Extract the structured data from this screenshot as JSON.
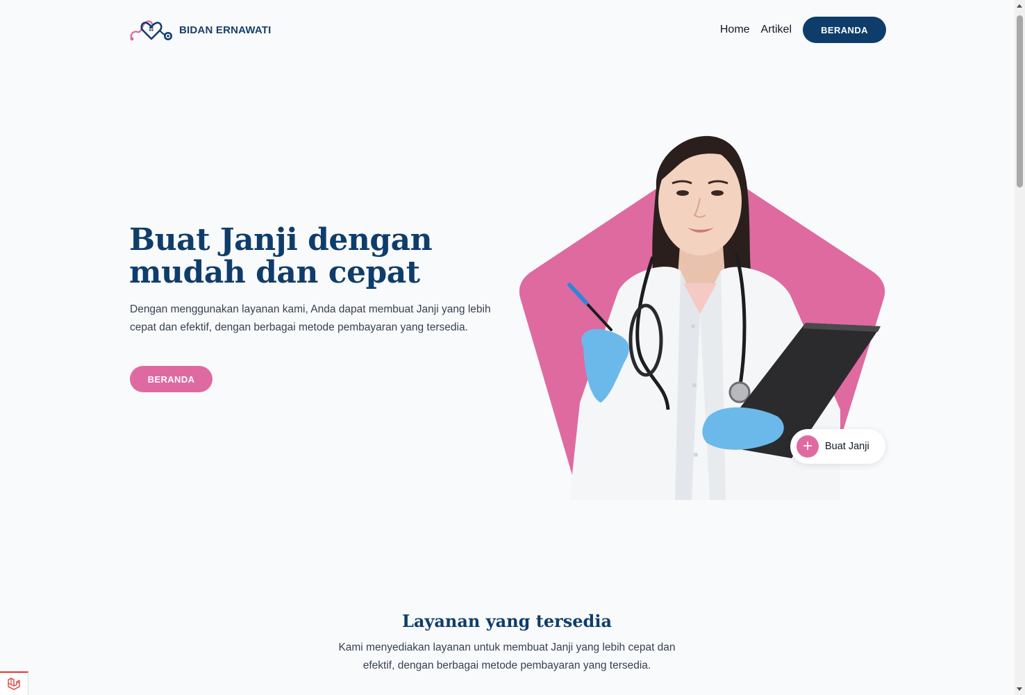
{
  "navbar": {
    "brand_name": "BIDAN ERNAWATI",
    "links": [
      "Home",
      "Artikel"
    ],
    "cta_label": "BERANDA"
  },
  "hero": {
    "title_line1": "Buat Janji dengan",
    "title_line2": "mudah dan cepat",
    "description": "Dengan menggunakan layanan kami, Anda dapat membuat Janji yang lebih cepat dan efektif, dengan berbagai metode pembayaran yang tersedia.",
    "button_label": "BERANDA",
    "fab_label": "Buat Janji"
  },
  "services": {
    "title": "Layanan yang tersedia",
    "description": "Kami menyediakan layanan untuk membuat Janji yang lebih cepat dan efektif, dengan berbagai metode pembayaran yang tersedia."
  },
  "colors": {
    "navy": "#0f3d6b",
    "pink": "#df6aa1",
    "background": "#f9fafb"
  },
  "icons": {
    "brand_logo": "heart-stethoscope-logo",
    "fab": "plus-icon",
    "debug": "laravel-icon"
  }
}
